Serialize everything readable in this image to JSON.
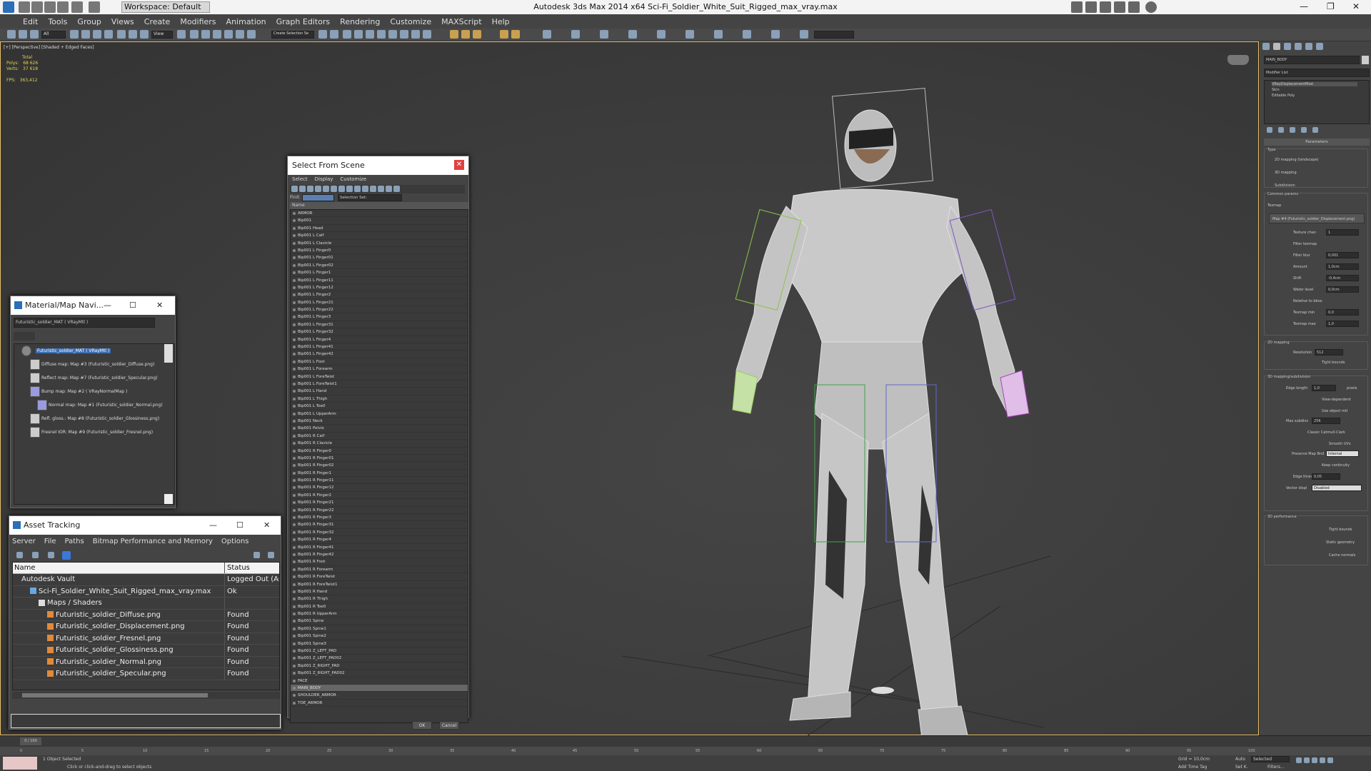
{
  "app": {
    "title": "Autodesk 3ds Max  2014 x64    Sci-Fi_Soldier_White_Suit_Rigged_max_vray.max",
    "workspace": "Workspace: Default"
  },
  "menu": [
    "Edit",
    "Tools",
    "Group",
    "Views",
    "Create",
    "Modifiers",
    "Animation",
    "Graph Editors",
    "Rendering",
    "Customize",
    "MAXScript",
    "Help"
  ],
  "toolbar": {
    "selection_filter": "All",
    "view_dropdown": "View",
    "named_selection": "Create Selection Se"
  },
  "viewport": {
    "label": "[+] [Perspective] [Shaded + Edged Faces]",
    "stats": {
      "total_label": "Total",
      "polys_label": "Polys:",
      "polys": "68 626",
      "verts_label": "Verts:",
      "verts": "37 618",
      "fps_label": "FPS:",
      "fps": "363,412"
    }
  },
  "select_from_scene": {
    "title": "Select From Scene",
    "menu": [
      "Select",
      "Display",
      "Customize"
    ],
    "find_label": "Find:",
    "selection_set_label": "Selection Set:",
    "column_name": "Name",
    "items": [
      "ARMOR",
      "Bip001",
      "Bip001 Head",
      "Bip001 L Calf",
      "Bip001 L Clavicle",
      "Bip001 L Finger0",
      "Bip001 L Finger01",
      "Bip001 L Finger02",
      "Bip001 L Finger1",
      "Bip001 L Finger11",
      "Bip001 L Finger12",
      "Bip001 L Finger2",
      "Bip001 L Finger21",
      "Bip001 L Finger22",
      "Bip001 L Finger3",
      "Bip001 L Finger31",
      "Bip001 L Finger32",
      "Bip001 L Finger4",
      "Bip001 L Finger41",
      "Bip001 L Finger42",
      "Bip001 L Foot",
      "Bip001 L Forearm",
      "Bip001 L ForeTwist",
      "Bip001 L ForeTwist1",
      "Bip001 L Hand",
      "Bip001 L Thigh",
      "Bip001 L Toe0",
      "Bip001 L UpperArm",
      "Bip001 Neck",
      "Bip001 Pelvis",
      "Bip001 R Calf",
      "Bip001 R Clavicle",
      "Bip001 R Finger0",
      "Bip001 R Finger01",
      "Bip001 R Finger02",
      "Bip001 R Finger1",
      "Bip001 R Finger11",
      "Bip001 R Finger12",
      "Bip001 R Finger2",
      "Bip001 R Finger21",
      "Bip001 R Finger22",
      "Bip001 R Finger3",
      "Bip001 R Finger31",
      "Bip001 R Finger32",
      "Bip001 R Finger4",
      "Bip001 R Finger41",
      "Bip001 R Finger42",
      "Bip001 R Foot",
      "Bip001 R Forearm",
      "Bip001 R ForeTwist",
      "Bip001 R ForeTwist1",
      "Bip001 R Hand",
      "Bip001 R Thigh",
      "Bip001 R Toe0",
      "Bip001 R UpperArm",
      "Bip001 Spine",
      "Bip001 Spine1",
      "Bip001 Spine2",
      "Bip001 Spine3",
      "Bip001 Z_LEFT_PAD",
      "Bip001 Z_LEFT_PAD02",
      "Bip001 Z_RIGHT_PAD",
      "Bip001 Z_RIGHT_PAD02",
      "FACE",
      "MAIN_BODY",
      "SHOULDER_ARMOR",
      "TOE_ARMOR"
    ],
    "selected_item": "MAIN_BODY",
    "ok": "OK",
    "cancel": "Cancel"
  },
  "material_navigator": {
    "title": "Material/Map Navi...",
    "field": "Futuristic_soldier_MAT  ( VRayMtl )",
    "root": "Futuristic_soldier_MAT  ( VRayMtl )",
    "rows": [
      "Diffuse map: Map #3 (Futuristic_soldier_Diffuse.png)",
      "Reflect map: Map #7 (Futuristic_soldier_Specular.png)",
      "Bump map: Map #2  ( VRayNormalMap )",
      "Normal map: Map #1 (Futuristic_soldier_Normal.png)",
      "Refl. gloss.: Map #8 (Futuristic_soldier_Glossiness.png)",
      "Fresnel IOR: Map #9 (Futuristic_soldier_Fresnel.png)"
    ]
  },
  "asset_tracking": {
    "title": "Asset Tracking",
    "menu": [
      "Server",
      "File",
      "Paths",
      "Bitmap Performance and Memory",
      "Options"
    ],
    "columns": [
      "Name",
      "Status"
    ],
    "rows": [
      {
        "name": "Autodesk Vault",
        "status": "Logged Out (Ass",
        "indent": 1
      },
      {
        "name": "Sci-Fi_Soldier_White_Suit_Rigged_max_vray.max",
        "status": "Ok",
        "indent": 2
      },
      {
        "name": "Maps / Shaders",
        "status": "",
        "indent": 3
      },
      {
        "name": "Futuristic_soldier_Diffuse.png",
        "status": "Found",
        "indent": 4
      },
      {
        "name": "Futuristic_soldier_Displacement.png",
        "status": "Found",
        "indent": 4
      },
      {
        "name": "Futuristic_soldier_Fresnel.png",
        "status": "Found",
        "indent": 4
      },
      {
        "name": "Futuristic_soldier_Glossiness.png",
        "status": "Found",
        "indent": 4
      },
      {
        "name": "Futuristic_soldier_Normal.png",
        "status": "Found",
        "indent": 4
      },
      {
        "name": "Futuristic_soldier_Specular.png",
        "status": "Found",
        "indent": 4
      }
    ]
  },
  "command_panel": {
    "object_name": "MAIN_BODY",
    "modifier_list": "Modifier List",
    "stack": [
      "VRayDisplacementMod",
      "Skin",
      "Editable Poly"
    ],
    "rollout": "Parameters",
    "type_label": "Type",
    "types": [
      "2D mapping (landscape)",
      "3D mapping",
      "Subdivision"
    ],
    "common_label": "Common params",
    "texmap_label": "Texmap",
    "texmap": "Map #4 (Futuristic_soldier_Displacement.png)",
    "params": [
      {
        "label": "Texture chan",
        "value": "1"
      },
      {
        "label": "Filter texmap",
        "value": ""
      },
      {
        "label": "Filter blur",
        "value": "0,001"
      },
      {
        "label": "Amount",
        "value": "1,0cm"
      },
      {
        "label": "Shift",
        "value": "-0,4cm"
      },
      {
        "label": "Water level",
        "value": "0,0cm"
      },
      {
        "label": "Relative to bbox",
        "value": ""
      },
      {
        "label": "Texmap min",
        "value": "0,0"
      },
      {
        "label": "Texmap max",
        "value": "1,0"
      }
    ],
    "mapping2d_label": "2D mapping",
    "resolution_label": "Resolution",
    "resolution": "512",
    "tight_bounds": "Tight bounds",
    "sub_label": "3D mapping/subdivision",
    "edge_length_label": "Edge length",
    "edge_length": "1,0",
    "pixels": "pixels",
    "sub_checks": [
      "View-dependent",
      "Use object mtl"
    ],
    "max_subdivs_label": "Max subdivs",
    "max_subdivs": "256",
    "sub_checks2": [
      "Classic Catmull-Clark",
      "Smooth UVs"
    ],
    "preserve_label": "Preserve Map Bnd",
    "preserve": "Internal",
    "keep_cont": "Keep continuity",
    "edge_thresh_label": "Edge thresh",
    "edge_thresh": "0,05",
    "vector_label": "Vector displ",
    "vector": "Disabled",
    "perf_label": "3D performance",
    "perf_checks": [
      "Tight bounds",
      "Static geometry",
      "Cache normals"
    ]
  },
  "timeline": {
    "frame": "0 / 100",
    "ticks": [
      "0",
      "5",
      "10",
      "15",
      "20",
      "25",
      "30",
      "35",
      "40",
      "45",
      "50",
      "55",
      "60",
      "65",
      "70",
      "75",
      "80",
      "85",
      "90",
      "95",
      "100"
    ]
  },
  "status": {
    "selected": "1 Object Selected",
    "prompt": "Click or click-and-drag to select objects",
    "grid": "Grid = 10,0cm",
    "add_time_tag": "Add Time Tag",
    "auto": "Auto",
    "selected_dropdown": "Selected",
    "set_k": "Set K.",
    "filters": "Filters..."
  },
  "colors": {
    "accent": "#e8c06a",
    "viewport_bg": "#3d3d3d",
    "panel": "#444444",
    "found": "#eeeeee"
  }
}
